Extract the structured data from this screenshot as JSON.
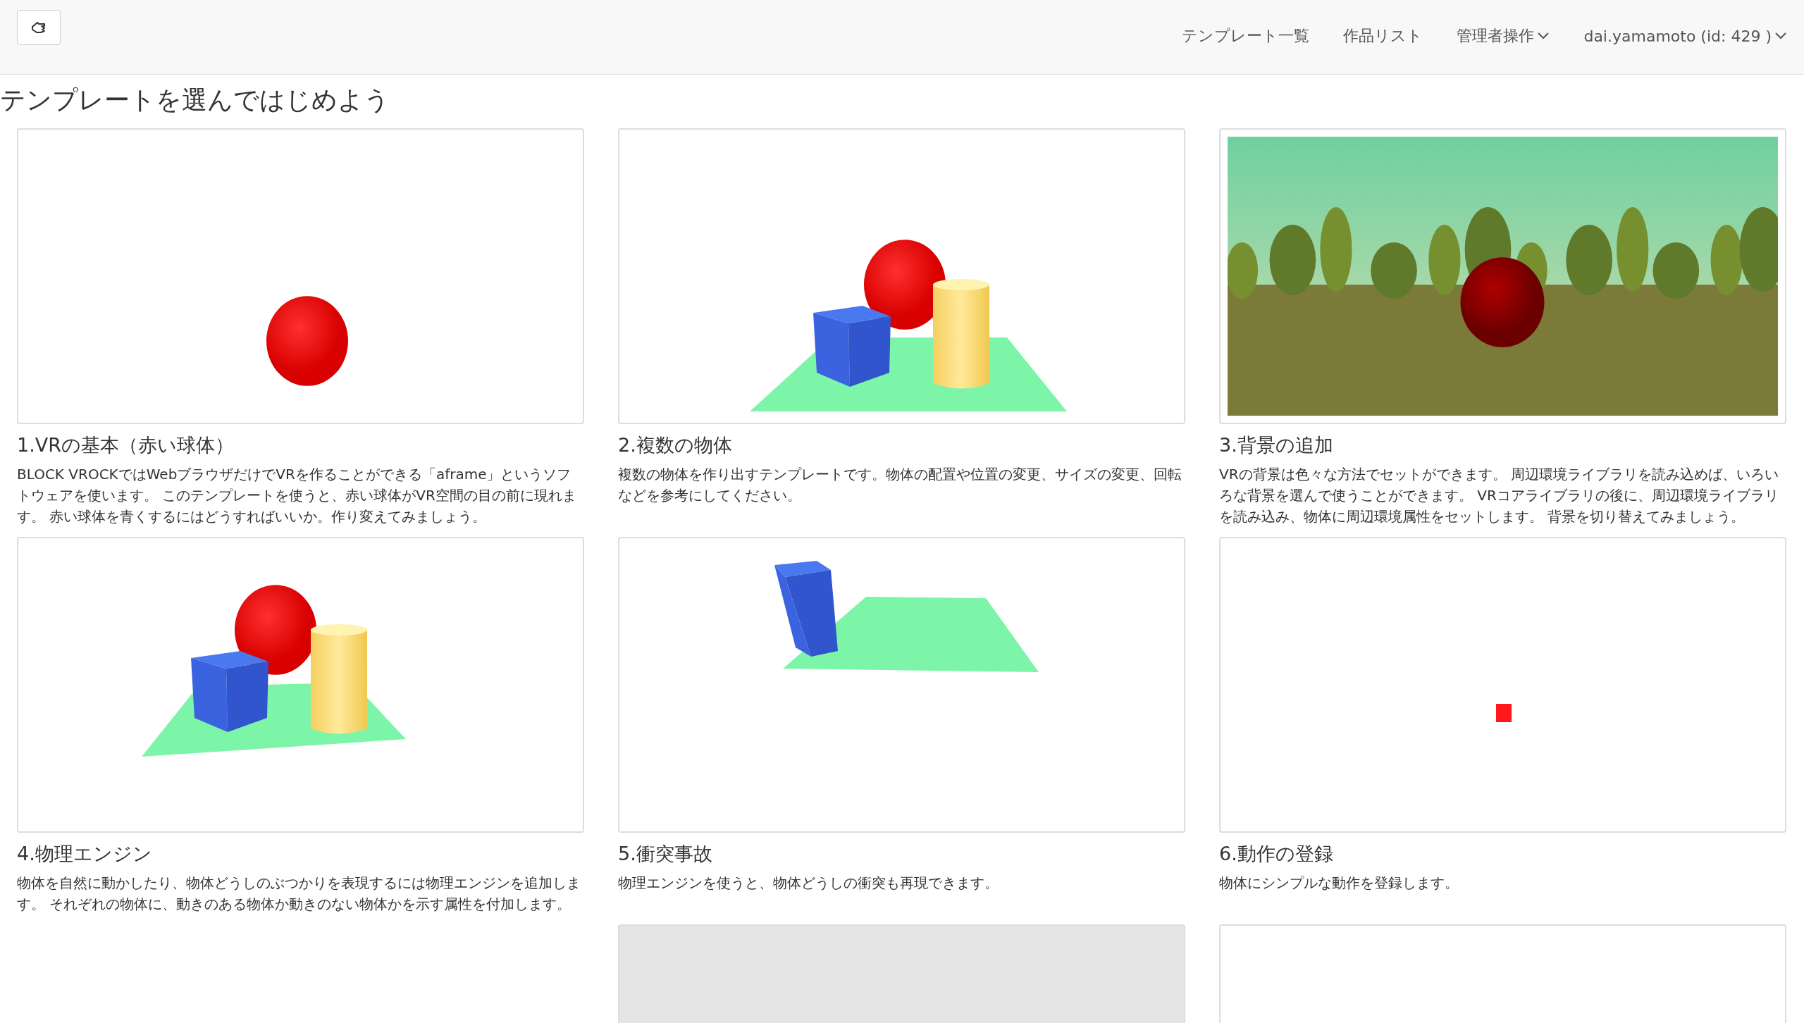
{
  "navbar": {
    "items": [
      {
        "label": "テンプレート一覧",
        "dropdown": false
      },
      {
        "label": "作品リスト",
        "dropdown": false
      },
      {
        "label": "管理者操作",
        "dropdown": true
      },
      {
        "label": "dai.yamamoto (id: 429 )",
        "dropdown": true
      }
    ]
  },
  "heading": "テンプレートを選んではじめよう",
  "cards": [
    {
      "kind": "sphere",
      "title": "1.VRの基本（赤い球体）",
      "description": "BLOCK VROCKではWebブラウザだけでVRを作ることができる「aframe」というソフトウェアを使います。 このテンプレートを使うと、赤い球体がVR空間の目の前に現れます。 赤い球体を青くするにはどうすればいいか。作り変えてみましょう。"
    },
    {
      "kind": "objects",
      "title": "2.複数の物体",
      "description": "複数の物体を作り出すテンプレートです。物体の配置や位置の変更、サイズの変更、回転などを参考にしてください。"
    },
    {
      "kind": "background",
      "title": "3.背景の追加",
      "description": "VRの背景は色々な方法でセットができます。 周辺環境ライブラリを読み込めば、いろいろな背景を選んで使うことができます。 VRコアライブラリの後に、周辺環境ライブラリを読み込み、物体に周辺環境属性をセットします。 背景を切り替えてみましょう。"
    },
    {
      "kind": "physics",
      "title": "4.物理エンジン",
      "description": "物体を自然に動かしたり、物体どうしのぶつかりを表現するには物理エンジンを追加します。 それぞれの物体に、動きのある物体か動きのない物体かを示す属性を付加します。"
    },
    {
      "kind": "collision",
      "title": "5.衝突事故",
      "description": "物理エンジンを使うと、物体どうしの衝突も再現できます。"
    },
    {
      "kind": "animation",
      "title": "6.動作の登録",
      "description": "物体にシンプルな動作を登録します。"
    }
  ],
  "next_row": [
    {
      "kind": "none"
    },
    {
      "kind": "shaded"
    },
    {
      "kind": "blank"
    }
  ]
}
